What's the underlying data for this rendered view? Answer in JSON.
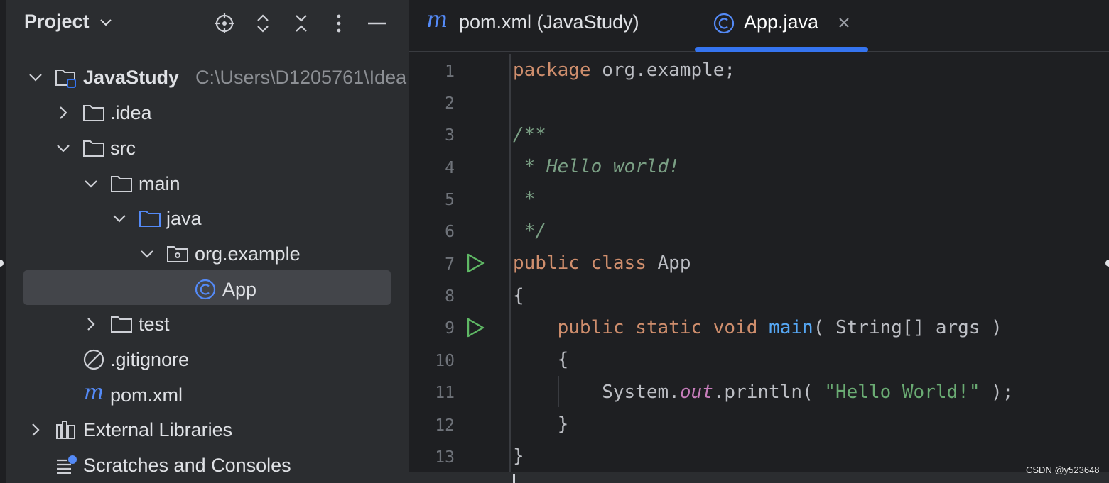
{
  "project_panel": {
    "title": "Project",
    "title_icon": "chevron-down-icon",
    "header_icons": [
      "locate-icon",
      "expand-all-icon",
      "collapse-all-icon",
      "more-options-icon",
      "hide-panel-icon"
    ],
    "tree": [
      {
        "label": "JavaStudy",
        "path": "C:\\Users\\D1205761\\Idea",
        "icon": "module-folder-icon",
        "expanded": true,
        "level": 0
      },
      {
        "label": ".idea",
        "icon": "folder-icon",
        "expanded": false,
        "level": 1
      },
      {
        "label": "src",
        "icon": "folder-icon",
        "expanded": true,
        "level": 1
      },
      {
        "label": "main",
        "icon": "folder-icon",
        "expanded": true,
        "level": 2
      },
      {
        "label": "java",
        "icon": "source-folder-icon",
        "expanded": true,
        "level": 3
      },
      {
        "label": "org.example",
        "icon": "package-icon",
        "expanded": true,
        "level": 4
      },
      {
        "label": "App",
        "icon": "class-icon",
        "selected": true,
        "level": 5
      },
      {
        "label": "test",
        "icon": "folder-icon",
        "expanded": false,
        "level": 2
      },
      {
        "label": ".gitignore",
        "icon": "ignored-file-icon",
        "level": 1
      },
      {
        "label": "pom.xml",
        "icon": "maven-icon",
        "level": 1
      },
      {
        "label": "External Libraries",
        "icon": "libraries-icon",
        "expanded": false,
        "level": 0
      },
      {
        "label": "Scratches and Consoles",
        "icon": "scratches-icon",
        "level": 0
      }
    ]
  },
  "editor": {
    "tabs": [
      {
        "label": "pom.xml (JavaStudy)",
        "icon": "maven-icon",
        "active": false
      },
      {
        "label": "App.java",
        "icon": "class-icon",
        "active": true,
        "close_icon": "close-icon"
      }
    ],
    "line_numbers": [
      "1",
      "2",
      "3",
      "4",
      "5",
      "6",
      "7",
      "8",
      "9",
      "10",
      "11",
      "12",
      "13"
    ],
    "code": {
      "l1_kw": "package",
      "l1_rest": " org.example;",
      "l3": "/**",
      "l4_star": " * ",
      "l4_text": "Hello world!",
      "l5": " *",
      "l6": " */",
      "l7_kw1": "public",
      "l7_kw2": "class",
      "l7_name": "App",
      "l8": "{",
      "l9_kw1": "public",
      "l9_kw2": "static",
      "l9_kw3": "void",
      "l9_fn": "main",
      "l9_rest": "( String[] args )",
      "l10": "{",
      "l11_obj": "System.",
      "l11_field": "out",
      "l11_call": ".println( ",
      "l11_str": "\"Hello World!\"",
      "l11_end": " );",
      "l12": "}",
      "l13": "}"
    },
    "gutter_icons": [
      "run-icon",
      "run-icon"
    ]
  },
  "watermark": "CSDN @y523648",
  "colors": {
    "background": "#1e1f22",
    "panel": "#2b2d30",
    "accent": "#3574f0",
    "keyword": "#cf8e6d",
    "comment": "#7a9f84",
    "string": "#6aab73",
    "function": "#56a8f5",
    "field": "#c77dbb"
  }
}
